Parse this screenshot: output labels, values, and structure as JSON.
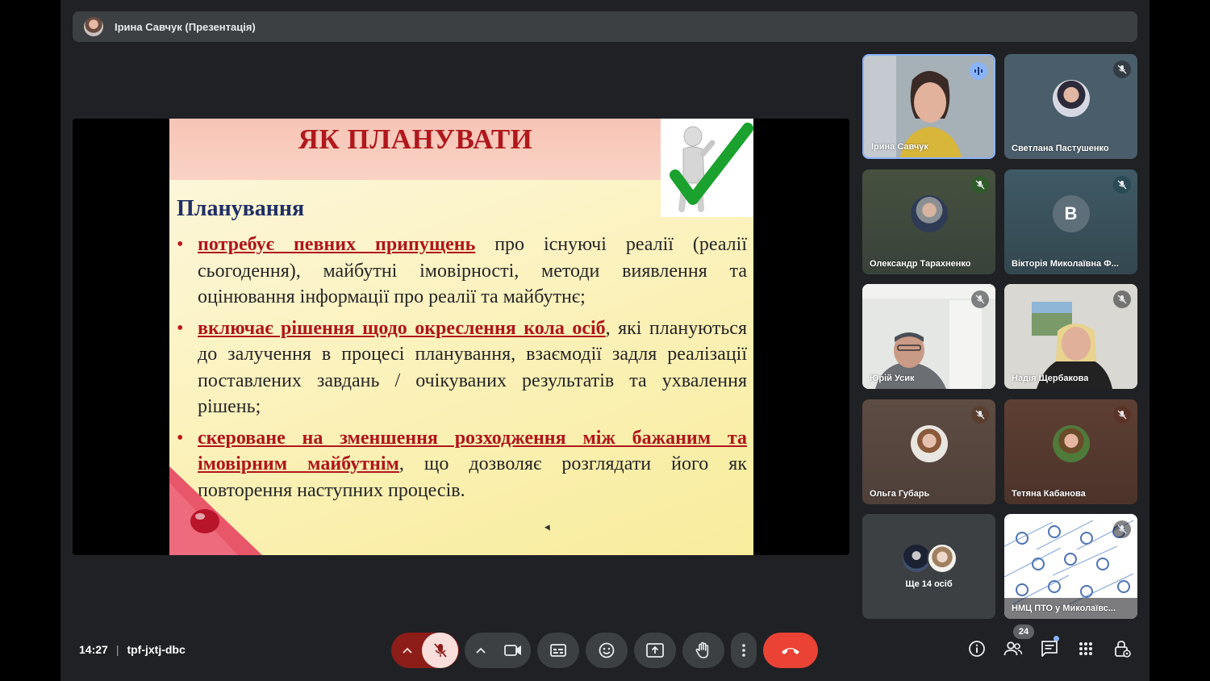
{
  "presenter_bar": {
    "name": "Ірина Савчук (Презентація)"
  },
  "slide": {
    "title": "ЯК ПЛАНУВАТИ",
    "heading": "Планування",
    "bullets": [
      {
        "emphasis": "потребує певних припущень",
        "rest": " про існуючі реалії (реалії сьогодення), майбутні імовірності, методи виявлення та оцінювання інформації про реалії та майбутнє;"
      },
      {
        "emphasis": "включає рішення щодо окреслення кола осіб",
        "rest": ", які плануються до залучення в процесі планування, взаємодії задля реалізації поставлених завдань / очікуваних результатів та ухвалення рішень;"
      },
      {
        "emphasis": "скероване на зменшення розходження між бажаним та імовірним майбутнім",
        "rest": ", що дозволяє розглядати його як повторення наступних процесів."
      }
    ]
  },
  "participants": [
    {
      "name": "Ірина Савчук",
      "mic": "speaking",
      "bg": "#9aa5ae"
    },
    {
      "name": "Светлана Пастушенко",
      "mic": "muted",
      "bg": "#4a5d6a"
    },
    {
      "name": "Олександр Тарахненко",
      "mic": "muted",
      "bg": "#3f4a3e"
    },
    {
      "name": "Вікторія Миколаївна Ф...",
      "mic": "muted",
      "bg": "#3e5663",
      "letter": "В"
    },
    {
      "name": "Юрій Усик",
      "mic": "muted",
      "bg": "#d7dcd9"
    },
    {
      "name": "Надія Щербакова",
      "mic": "muted",
      "bg": "#cfcfcd"
    },
    {
      "name": "Ольга Губарь",
      "mic": "muted",
      "bg": "#5a4a42"
    },
    {
      "name": "Тетяна Кабанова",
      "mic": "muted",
      "bg": "#5b3d32"
    },
    {
      "name": "НМЦ ПТО у Миколаївс...",
      "mic": "muted",
      "bg": "#ffffff"
    }
  ],
  "more": {
    "label": "Ще 14 осіб"
  },
  "meeting": {
    "time": "14:27",
    "separator": "|",
    "code": "tpf-jxtj-dbc"
  },
  "participants_count": "24",
  "colors": {
    "end_call": "#ea4335",
    "mic_off_bg": "#f9dedc",
    "mic_off_icon": "#8c1d18",
    "speaking": "#8ab4f8"
  },
  "icons": [
    "chevron-up-icon",
    "mic-off-icon",
    "camera-icon",
    "captions-icon",
    "emoji-icon",
    "present-icon",
    "raise-hand-icon",
    "more-vert-icon",
    "end-call-icon",
    "info-icon",
    "people-icon",
    "chat-icon",
    "activities-icon",
    "host-controls-icon"
  ]
}
